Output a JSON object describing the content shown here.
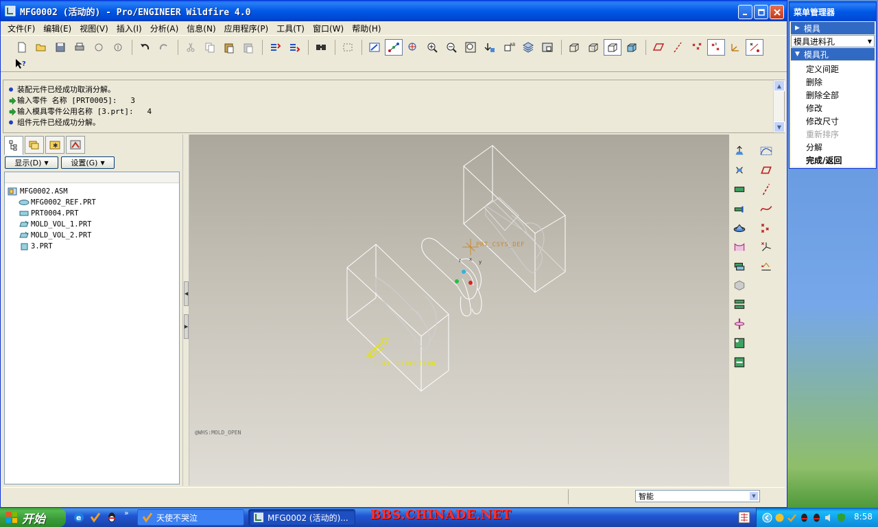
{
  "window": {
    "title": "MFG0002 (活动的) - Pro/ENGINEER Wildfire 4.0",
    "controls": [
      "minimize",
      "maximize",
      "close"
    ]
  },
  "menubar": [
    "文件(F)",
    "编辑(E)",
    "视图(V)",
    "插入(I)",
    "分析(A)",
    "信息(N)",
    "应用程序(P)",
    "工具(T)",
    "窗口(W)",
    "帮助(H)"
  ],
  "toolbar": {
    "icons": [
      "new-icon",
      "open-icon",
      "save-icon",
      "print-icon",
      "send-mail-icon",
      "send-mail-attach-icon",
      "undo-icon",
      "redo-icon",
      "cut-icon",
      "copy-icon",
      "paste-icon",
      "paste-special-icon",
      "regenerate-icon",
      "regen-manager-icon",
      "find-icon",
      "select-box-icon",
      "repaint-icon",
      "spin-center-icon",
      "orient-mode-icon",
      "zoom-in-icon",
      "zoom-out-icon",
      "refit-icon",
      "reorient-icon",
      "saved-views-icon",
      "layers-icon",
      "view-manager-icon",
      "wireframe-icon",
      "hidden-line-icon",
      "no-hidden-icon",
      "shaded-icon",
      "datum-planes-icon",
      "datum-axes-icon",
      "datum-points-icon",
      "point-names-icon",
      "csys-icon",
      "annotations-icon"
    ],
    "context_help_icon": "context-help-icon"
  },
  "messages": [
    {
      "type": "info",
      "text": "装配元件已经成功取消分解。"
    },
    {
      "type": "prompt",
      "text": "输入零件 名称 [PRT0005]:   3"
    },
    {
      "type": "prompt",
      "text": "输入模具零件公用名称 [3.prt]:   4"
    },
    {
      "type": "info",
      "text": "组件元件已经成功分解。"
    }
  ],
  "left_panel": {
    "tabs": [
      "model-tree-tab",
      "folder-browser-tab",
      "favorites-tab",
      "connections-tab"
    ],
    "show_button": "显示(D)",
    "settings_button": "设置(G)",
    "tree": {
      "root": "MFG0002.ASM",
      "children": [
        "MFG0002_REF.PRT",
        "PRT0004.PRT",
        "MOLD_VOL_1.PRT",
        "MOLD_VOL_2.PRT",
        "3.PRT"
      ]
    }
  },
  "graphics": {
    "csys_label": "PRT_CSYS_DEF",
    "pull_label": "PULL DIRECTION",
    "state_label": "@WHS:MOLD_OPEN"
  },
  "right_toolbar": {
    "icons": [
      "mold-model-icon",
      "define-blank-icon",
      "refpart-cutout-icon",
      "pattern-icon",
      "mold-volume-icon",
      "mold-parting-surface-icon",
      "split-volume-icon",
      "extract-icon",
      "mold-opening-icon",
      "runner-icon",
      "waterline-icon",
      "molding-icon",
      "datum-sketch-icon",
      "datum-plane-icon",
      "datum-axis-icon",
      "datum-curve-icon",
      "datum-point-icon",
      "csys-tool-icon",
      "analysis-tool-icon"
    ]
  },
  "status": {
    "filter_value": "智能"
  },
  "menu_manager": {
    "title": "菜单管理器",
    "section1": "模具",
    "combo_value": "模具进料孔",
    "section2": "模具孔",
    "items": [
      {
        "label": "定义间距",
        "enabled": true,
        "bold": false
      },
      {
        "label": "删除",
        "enabled": true,
        "bold": false
      },
      {
        "label": "删除全部",
        "enabled": true,
        "bold": false
      },
      {
        "label": "修改",
        "enabled": true,
        "bold": false
      },
      {
        "label": "修改尺寸",
        "enabled": true,
        "bold": false
      },
      {
        "label": "重新排序",
        "enabled": false,
        "bold": false
      },
      {
        "label": "分解",
        "enabled": true,
        "bold": false
      },
      {
        "label": "完成/返回",
        "enabled": true,
        "bold": true
      }
    ]
  },
  "taskbar": {
    "start_label": "开始",
    "tasks": [
      "天使不哭泣",
      "MFG0002 (活动的)..."
    ],
    "watermark": "BBS.CHINADE.NET",
    "clock": "8:58"
  },
  "colors": {
    "title_blue": "#0058e6",
    "graphics_bg_top": "#aca79c",
    "csys_orange": "#c88a30",
    "pull_yellow": "#e4e400"
  }
}
